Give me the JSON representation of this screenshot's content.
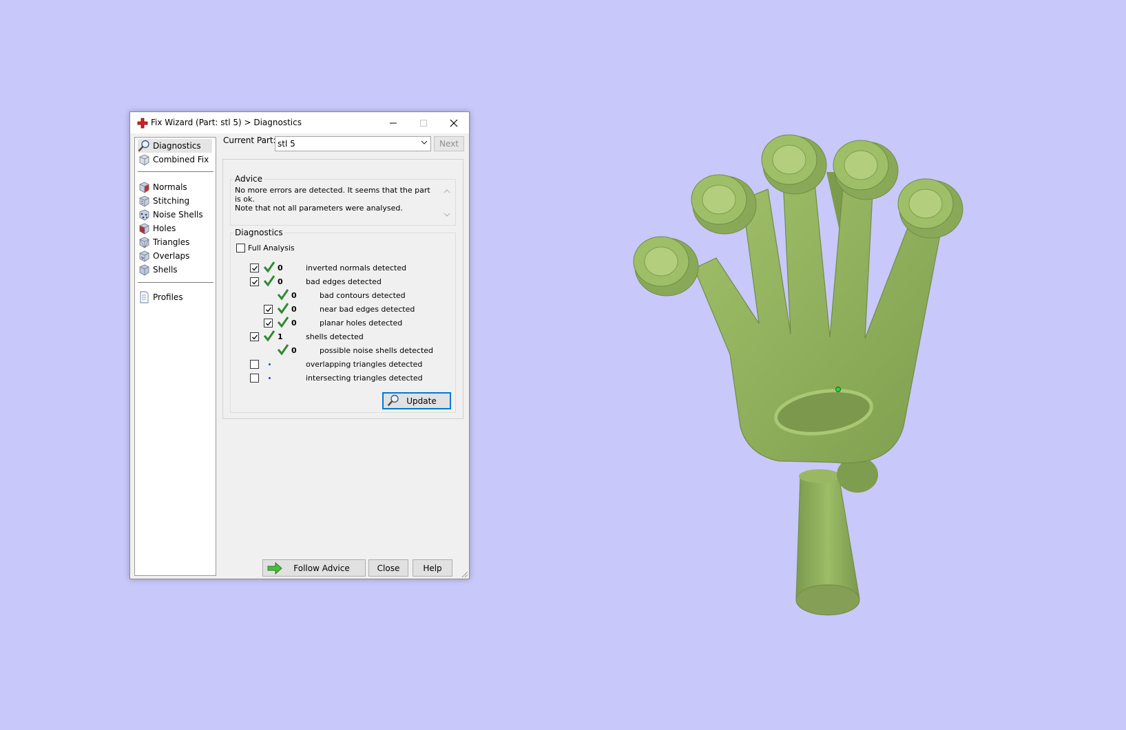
{
  "window": {
    "title": "Fix Wizard (Part: stl 5) > Diagnostics",
    "minimize_label": "–",
    "maximize_label": "□",
    "close_label": "✕"
  },
  "nav": {
    "items": [
      {
        "label": "Diagnostics",
        "icon": "magnifier-icon",
        "selected": true
      },
      {
        "label": "Combined Fix",
        "icon": "cube-icon"
      },
      {
        "label": "Normals",
        "icon": "normals-cube-icon"
      },
      {
        "label": "Stitching",
        "icon": "stitching-cube-icon"
      },
      {
        "label": "Noise Shells",
        "icon": "noise-shells-icon"
      },
      {
        "label": "Holes",
        "icon": "holes-cube-icon"
      },
      {
        "label": "Triangles",
        "icon": "triangles-cube-icon"
      },
      {
        "label": "Overlaps",
        "icon": "overlaps-cube-icon"
      },
      {
        "label": "Shells",
        "icon": "shells-cube-icon"
      },
      {
        "label": "Profiles",
        "icon": "document-icon"
      }
    ]
  },
  "current_part": {
    "label": "Current Part:",
    "value": "stl 5",
    "next_label": "Next"
  },
  "advice": {
    "title": "Advice",
    "line1": "No more errors are detected. It seems that the part is ok.",
    "line2": "Note that not all parameters were analysed."
  },
  "diagnostics": {
    "title": "Diagnostics",
    "full_analysis_label": "Full Analysis",
    "full_analysis_checked": false,
    "rows": [
      {
        "checkbox": true,
        "checked": true,
        "status": "ok",
        "count": "0",
        "text": "inverted normals detected",
        "indent": 0
      },
      {
        "checkbox": true,
        "checked": true,
        "status": "ok",
        "count": "0",
        "text": "bad edges detected",
        "indent": 0
      },
      {
        "checkbox": false,
        "checked": false,
        "status": "ok",
        "count": "0",
        "text": "bad contours detected",
        "indent": 1
      },
      {
        "checkbox": true,
        "checked": true,
        "status": "ok",
        "count": "0",
        "text": "near bad edges detected",
        "indent": 1
      },
      {
        "checkbox": true,
        "checked": true,
        "status": "ok",
        "count": "0",
        "text": "planar holes detected",
        "indent": 1
      },
      {
        "checkbox": true,
        "checked": true,
        "status": "ok",
        "count": "1",
        "text": "shells detected",
        "indent": 0
      },
      {
        "checkbox": false,
        "checked": false,
        "status": "ok",
        "count": "0",
        "text": "possible noise shells detected",
        "indent": 1
      },
      {
        "checkbox": true,
        "checked": false,
        "status": "pending",
        "count": "",
        "text": "overlapping triangles detected",
        "indent": 0
      },
      {
        "checkbox": true,
        "checked": false,
        "status": "pending",
        "count": "",
        "text": "intersecting triangles detected",
        "indent": 0
      }
    ],
    "update_label": "Update"
  },
  "footer": {
    "follow_advice_label": "Follow Advice",
    "close_label": "Close",
    "help_label": "Help"
  },
  "colors": {
    "background": "#c8c8fa",
    "model_green": "#8fae5c",
    "tick_green": "#2e8b2e",
    "accent_blue": "#0078d7"
  }
}
